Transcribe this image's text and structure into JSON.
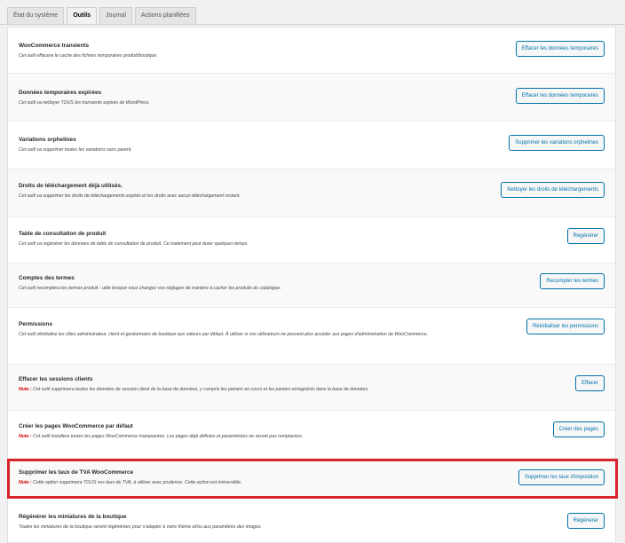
{
  "tabs": [
    {
      "label": "État du système"
    },
    {
      "label": "Outils"
    },
    {
      "label": "Journal"
    },
    {
      "label": "Actions planifiées"
    }
  ],
  "active_tab": "Outils",
  "note_label": "Note :",
  "tools": [
    {
      "name": "WooCommerce transients",
      "desc": "Cet outil effacera le cache des fichiers temporaires produit/boutique.",
      "button": "Effacer les données temporaires"
    },
    {
      "name": "Données temporaires expirées",
      "desc": "Cet outil va nettoyer TOUS les transients expirés de WordPress.",
      "button": "Effacer les données temporaires"
    },
    {
      "name": "Variations orphelines",
      "desc": "Cet outil va supprimer toutes les variations sans parent.",
      "button": "Supprimer les variations orphelines"
    },
    {
      "name": "Droits de téléchargement déjà utilisés.",
      "desc": "Cet outil va supprimer les droits de téléchargements expirés et les droits avec aucun téléchargement restant.",
      "button": "Nettoyer les droits de téléchargements"
    },
    {
      "name": "Table de consultation de produit",
      "desc": "Cet outil va regénérer les données de table de consultation de produit. Ce traitement peut durer quelques temps.",
      "button": "Regénérer"
    },
    {
      "name": "Comptes des termes",
      "desc": "Cet outil recomptera les termes produit - utile lorsque vous changez vos réglages de manière à cacher les produits du catalogue.",
      "button": "Recompter les termes"
    },
    {
      "name": "Permissions",
      "desc": "Cet outil réinitialise les rôles administrateur, client et gestionnaire de boutique aux valeurs par défaut. À utiliser si vos utilisateurs ne peuvent plus accéder aux pages d'administration de WooCommerce.",
      "button": "Réinitialiser les permissions"
    },
    {
      "name": "Effacer les sessions clients",
      "note": "Cet outil supprimera toutes les données de session client de la base de données, y compris les paniers en cours et les paniers enregistrés dans la base de données.",
      "button": "Effacer"
    },
    {
      "name": "Créer les pages WooCommerce par défaut",
      "note": "Cet outil installera toutes les pages WooCommerce manquantes. Les pages déjà définies et paramétrées ne seront pas remplacées.",
      "button": "Créer des pages"
    },
    {
      "name": "Supprimer les taux de TVA WooCommerce",
      "note": "Cette option supprimera TOUS vos taux de TVA, à utiliser avec prudence. Cette action est irréversible.",
      "button": "Supprimer les taux d'imposition"
    },
    {
      "name": "Régénérer les miniatures de la boutique",
      "desc": "Toutes les miniatures de la boutique seront régénérées pour s'adapter à votre thème et/ou aux paramètres des images.",
      "button": "Régénérer"
    }
  ]
}
